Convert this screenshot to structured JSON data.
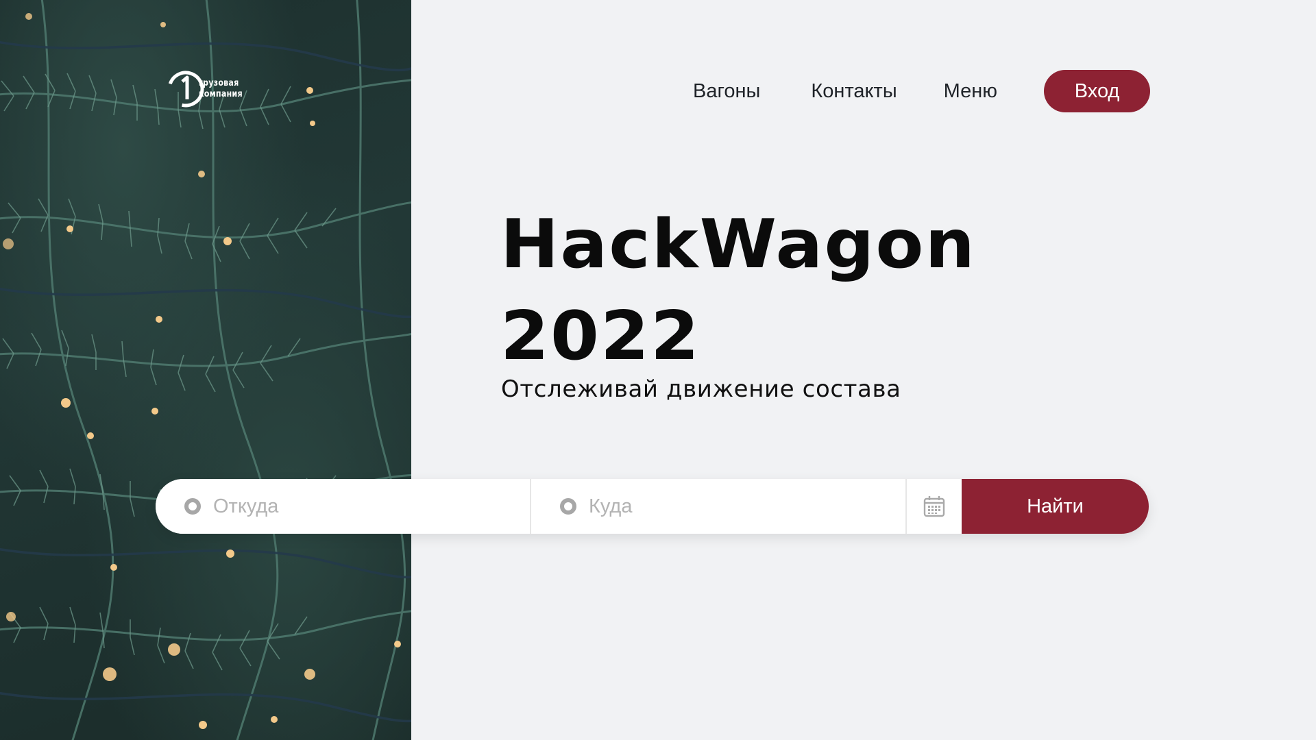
{
  "brand": {
    "logo_line1": "грузовая",
    "logo_line2": "компания"
  },
  "nav": {
    "items": [
      {
        "label": "Вагоны"
      },
      {
        "label": "Контакты"
      },
      {
        "label": "Меню"
      }
    ],
    "login_label": "Вход"
  },
  "hero": {
    "title_line1": "HackWagon",
    "title_line2": "2022",
    "subtitle": "Отслеживай движение состава"
  },
  "search": {
    "from_placeholder": "Откуда",
    "to_placeholder": "Куда",
    "submit_label": "Найти"
  },
  "colors": {
    "accent": "#8d2233",
    "background": "#f1f2f4"
  },
  "icons": [
    "logo-mark-icon",
    "location-dot-icon",
    "calendar-icon"
  ]
}
